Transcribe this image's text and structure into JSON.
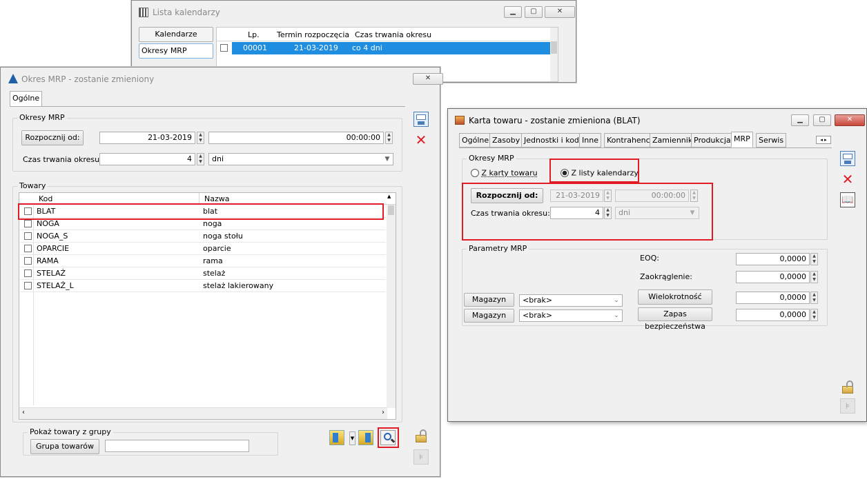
{
  "lista": {
    "title": "Lista kalendarzy",
    "side_btns": [
      "Kalendarze zasobów",
      "Okresy MRP"
    ],
    "cols": [
      "Lp.",
      "Termin rozpoczęcia",
      "Czas trwania okresu"
    ],
    "row": {
      "lp": "00001",
      "termin": "21-03-2019",
      "czas": "co 4 dni"
    }
  },
  "okres": {
    "title": "Okres MRP - zostanie zmieniony",
    "tab": "Ogólne",
    "group_label": "Okresy MRP",
    "start_btn": "Rozpocznij od:",
    "date": "21-03-2019",
    "time": "00:00:00",
    "duration_label": "Czas trwania okresu:",
    "duration": "4",
    "unit": "dni",
    "towary_label": "Towary",
    "cols": [
      "Kod",
      "Nazwa"
    ],
    "rows": [
      {
        "kod": "BLAT",
        "nazwa": "blat"
      },
      {
        "kod": "NOGA",
        "nazwa": "noga"
      },
      {
        "kod": "NOGA_S",
        "nazwa": "noga stołu"
      },
      {
        "kod": "OPARCIE",
        "nazwa": "oparcie"
      },
      {
        "kod": "RAMA",
        "nazwa": "rama"
      },
      {
        "kod": "STELAŻ",
        "nazwa": "stelaż"
      },
      {
        "kod": "STELAŻ_L",
        "nazwa": "stelaż lakierowany"
      }
    ],
    "group_show": "Pokaż towary z grupy",
    "group_btn": "Grupa towarów",
    "group_value": ""
  },
  "karta": {
    "title": "Karta towaru - zostanie zmieniona (BLAT)",
    "tabs": [
      "Ogólne",
      "Zasoby",
      "Jednostki i kody",
      "Inne",
      "Kontrahenci",
      "Zamienniki",
      "Produkcja",
      "MRP",
      "Serwis"
    ],
    "okresy_label": "Okresy MRP",
    "radio1": "Z karty towaru",
    "radio2": "Z listy kalendarzy",
    "start_btn": "Rozpocznij od:",
    "date": "21-03-2019",
    "time": "00:00:00",
    "duration_label": "Czas trwania okresu:",
    "duration": "4",
    "unit": "dni",
    "params_label": "Parametry MRP",
    "eoq_label": "EOQ:",
    "eoq": "0,0000",
    "zaok_label": "Zaokrąglenie:",
    "zaok": "0,0000",
    "magazyn_btn": "Magazyn",
    "magazyn_val": "<brak>",
    "wiel_btn": "Wielokrotność",
    "wiel": "0,0000",
    "zapas_btn": "Zapas bezpieczeństwa",
    "zapas": "0,0000"
  }
}
